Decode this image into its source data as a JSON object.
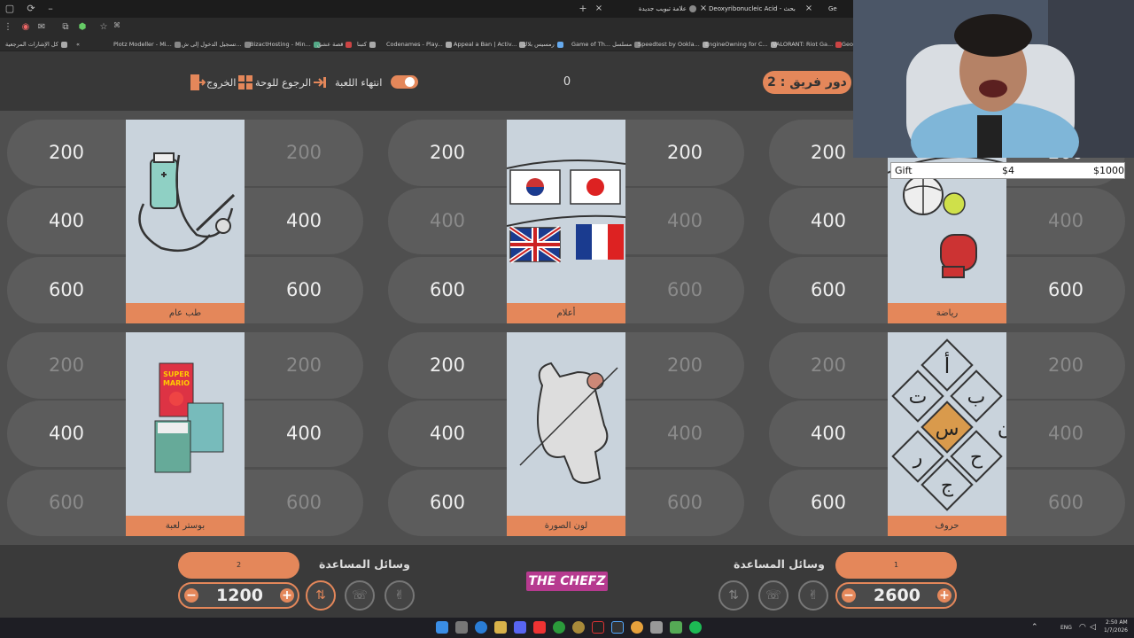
{
  "browser": {
    "tabs": [
      {
        "title": "Ge"
      },
      {
        "title": "Deoxyribonucleic Acid - بحث"
      },
      {
        "title": "علامة تبويب جديدة"
      }
    ],
    "address": "⌘",
    "bookmarks": [
      "كل الإشارات المرجعية",
      "Plotz Modeller - Mi...",
      "تسجيل الدخول إلى ش...",
      "BizactHosting - Min...",
      "قصة عشق",
      "كتبنا",
      "Codenames - Play...",
      "Appeal a Ban | Activ...",
      "رمسيس بلاك",
      "Game of Th... مسلسل",
      "Speedtest by Ookla...",
      "EngineOwning for C...",
      "VALORANT: Riot Ga...",
      "Geo"
    ]
  },
  "header": {
    "turn_label": "دور فريق : 2",
    "counter": "0",
    "end_game": "انتهاء اللعبة",
    "back_to_board": "الرجوع للوحة",
    "exit": "الخروج"
  },
  "categories": [
    {
      "label": "طب عام",
      "left": [
        "200",
        "400",
        "600"
      ],
      "right": [
        "200",
        "400",
        "600"
      ],
      "left_used": [
        false,
        false,
        false
      ],
      "right_used": [
        true,
        false,
        false
      ]
    },
    {
      "label": "أعلام",
      "left": [
        "200",
        "400",
        "600"
      ],
      "right": [
        "200",
        "400",
        "600"
      ],
      "left_used": [
        false,
        true,
        false
      ],
      "right_used": [
        false,
        true,
        true
      ]
    },
    {
      "label": "رياضة",
      "left": [
        "200",
        "400",
        "600"
      ],
      "right": [
        "200",
        "400",
        "600"
      ],
      "left_used": [
        false,
        false,
        false
      ],
      "right_used": [
        false,
        true,
        false
      ]
    },
    {
      "label": "بوستر لعبة",
      "left": [
        "200",
        "400",
        "600"
      ],
      "right": [
        "200",
        "400",
        "600"
      ],
      "left_used": [
        true,
        false,
        true
      ],
      "right_used": [
        true,
        false,
        true
      ]
    },
    {
      "label": "لون الصورة",
      "left": [
        "200",
        "400",
        "600"
      ],
      "right": [
        "200",
        "400",
        "600"
      ],
      "left_used": [
        false,
        false,
        false
      ],
      "right_used": [
        true,
        true,
        true
      ]
    },
    {
      "label": "حروف",
      "left": [
        "200",
        "400",
        "600"
      ],
      "right": [
        "200",
        "400",
        "600"
      ],
      "left_used": [
        true,
        false,
        false
      ],
      "right_used": [
        true,
        true,
        true
      ]
    }
  ],
  "letters_card": [
    "أ",
    "ب",
    "ت",
    "س",
    "ج",
    "ح",
    "ر",
    "ن"
  ],
  "team2": {
    "name": "2",
    "help_label": "وسائل المساعدة",
    "score": "1200",
    "minus": "−",
    "plus": "+"
  },
  "team1": {
    "name": "1",
    "help_label": "وسائل المساعدة",
    "score": "2600",
    "minus": "−",
    "plus": "+"
  },
  "logo": "THE CHEFZ",
  "gift_bar": {
    "label": "Gift",
    "amount": "$4",
    "goal": "$1000"
  },
  "tray": {
    "lang": "ENG",
    "time": "2:50 AM",
    "date": "1/7/2026"
  }
}
